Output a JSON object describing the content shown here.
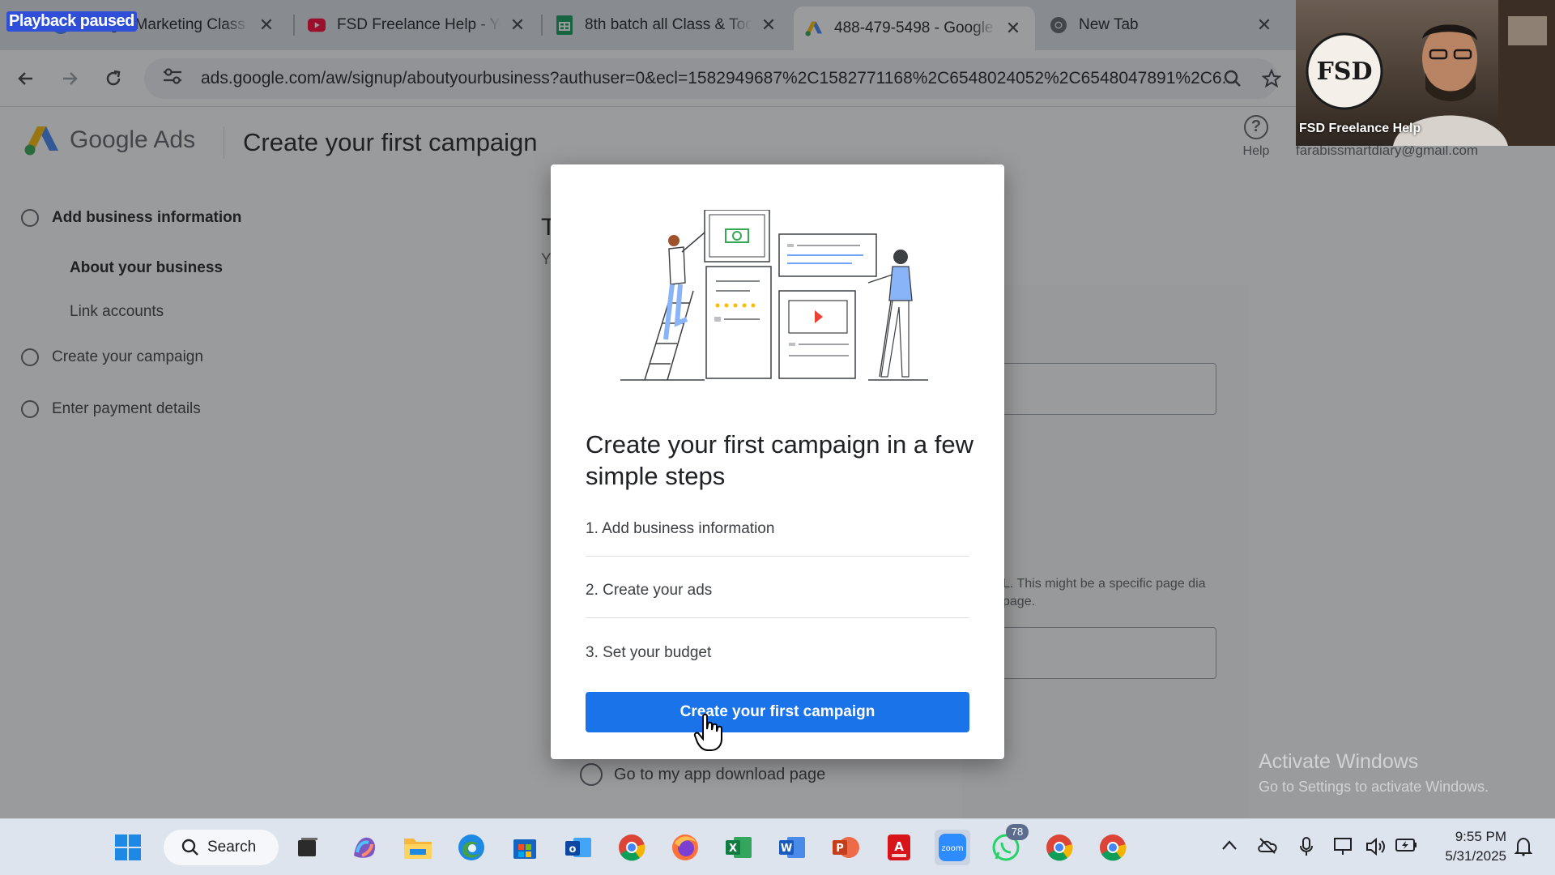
{
  "overlay_label": "Playback paused",
  "browser": {
    "tabs": [
      {
        "title": "Google Marketing Class N",
        "icon": "google-icon",
        "active": false
      },
      {
        "title": "FSD Freelance Help - You",
        "icon": "youtube-icon",
        "active": false
      },
      {
        "title": "8th batch all Class & Too",
        "icon": "sheets-icon",
        "active": false
      },
      {
        "title": "488-479-5498 - Google A",
        "icon": "google-ads-icon",
        "active": true
      },
      {
        "title": "New Tab",
        "icon": "chrome-icon",
        "active": false
      }
    ],
    "address": "ads.google.com/aw/signup/aboutyourbusiness?authuser=0&ecl=1582949687%2C1582771168%2C6548024052%2C6548047891%2C6..."
  },
  "page": {
    "brand": "Google Ads",
    "title": "Create your first campaign",
    "help_label": "Help",
    "account_email": "farabissmartdiary@gmail.com",
    "sidebar": {
      "steps": [
        {
          "label": "Add business information",
          "bold": true
        },
        {
          "label": "About your business",
          "sub": true,
          "bold": true
        },
        {
          "label": "Link accounts",
          "sub": true
        },
        {
          "label": "Create your campaign"
        },
        {
          "label": "Enter payment details"
        }
      ]
    },
    "background": {
      "heading_initial": "T",
      "sub_initial": "Y",
      "hint_text": "L. This might be a specific page dia page.",
      "radio_label": "Go to my app download page"
    }
  },
  "modal": {
    "title": "Create your first campaign in a few simple steps",
    "steps": [
      "1. Add business information",
      "2. Create your ads",
      "3. Set your budget"
    ],
    "cta": "Create your first campaign"
  },
  "watermark": {
    "line1": "Activate Windows",
    "line2": "Go to Settings to activate Windows."
  },
  "webcam": {
    "label": "FSD Freelance Help",
    "logo_text": "FSD"
  },
  "taskbar": {
    "search_label": "Search",
    "whatsapp_badge": "78",
    "time": "9:55 PM",
    "date": "5/31/2025"
  },
  "colors": {
    "accent": "#1a73e8",
    "scrim": "#202124",
    "taskbar": "#dde4ee"
  }
}
